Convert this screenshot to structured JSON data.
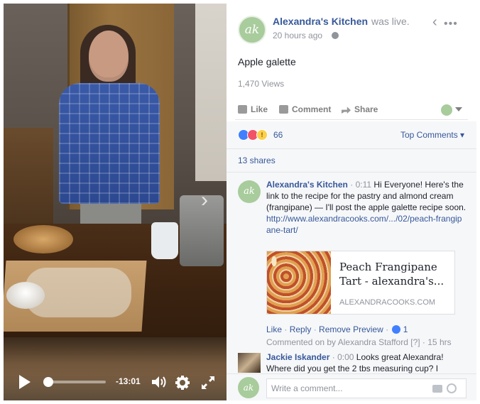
{
  "video": {
    "time_remaining": "-13:01",
    "progress_fraction": 0.04,
    "next_glyph": "›"
  },
  "post": {
    "page_name": "Alexandra's Kitchen",
    "status": "was live.",
    "timestamp": "20 hours ago",
    "title": "Apple galette",
    "views": "1,470 Views",
    "avatar_text": "ak",
    "back_glyph": "‹",
    "more_glyph": "•••"
  },
  "actions": {
    "like": "Like",
    "comment": "Comment",
    "share": "Share"
  },
  "engagement": {
    "reaction_count": "66",
    "sort_label": "Top Comments",
    "shares": "13 shares",
    "wow_glyph": "!"
  },
  "comments": [
    {
      "author": "Alexandra's Kitchen",
      "time": "0:11",
      "text": "Hi Everyone! Here's the link to the recipe for the pastry and almond cream (frangipane) — I'll post the apple galette recipe soon.",
      "link": "http://www.alexandracooks.com/.../02/peach-frangipane-tart/",
      "preview": {
        "title": "Peach Frangipane Tart - alexandra's...",
        "domain": "ALEXANDRACOOKS.COM"
      },
      "meta": {
        "like": "Like",
        "reply": "Reply",
        "remove_preview": "Remove Preview",
        "like_count": "1",
        "separator": " · "
      },
      "commented_on_by": "Commented on by Alexandra Stafford",
      "commented_suffix": "[?] · 15 hrs"
    },
    {
      "author": "Jackie Iskander",
      "time": "0:00",
      "text": "Looks great Alexandra! Where did you get the 2 tbs measuring cup? I"
    }
  ],
  "compose": {
    "placeholder": "Write a comment..."
  },
  "colors": {
    "link_blue": "#365899",
    "meta_gray": "#90949c",
    "avatar_green": "#a8cc9c",
    "like_blue": "#4080ff",
    "love_red": "#f25268",
    "wow_yellow": "#fcd04a"
  },
  "icons": [
    "play-icon",
    "volume-icon",
    "gear-icon",
    "expand-icon",
    "globe-icon",
    "back-icon",
    "more-icon",
    "like-icon",
    "comment-icon",
    "share-icon",
    "camera-icon",
    "emoji-icon"
  ]
}
